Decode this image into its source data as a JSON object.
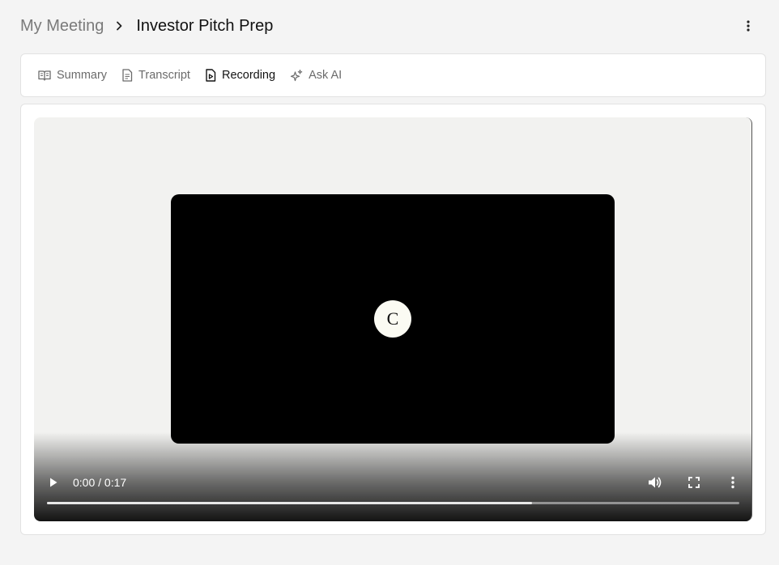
{
  "breadcrumb": {
    "parent": "My Meeting",
    "current": "Investor Pitch Prep"
  },
  "tabs": [
    {
      "label": "Summary",
      "icon": "book-open-icon",
      "active": false
    },
    {
      "label": "Transcript",
      "icon": "document-text-icon",
      "active": false
    },
    {
      "label": "Recording",
      "icon": "file-play-icon",
      "active": true
    },
    {
      "label": "Ask AI",
      "icon": "sparkles-icon",
      "active": false
    }
  ],
  "video": {
    "logo_text": "C",
    "time_display": "0:00 / 0:17",
    "buffered_fraction": 0.7
  },
  "colors": {
    "background": "#f4f4f4",
    "card": "#ffffff",
    "video_frame": "#000000",
    "text_muted": "#6b6b6b"
  }
}
